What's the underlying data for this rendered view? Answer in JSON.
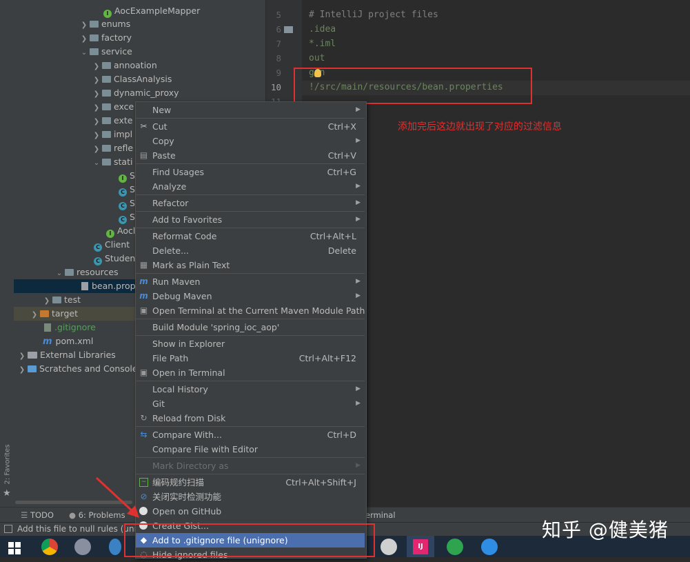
{
  "tree": {
    "items": [
      {
        "label": "AocExampleMapper"
      },
      {
        "label": "enums"
      },
      {
        "label": "factory"
      },
      {
        "label": "service"
      },
      {
        "label": "annoation"
      },
      {
        "label": "ClassAnalysis"
      },
      {
        "label": "dynamic_proxy"
      },
      {
        "label": "exce"
      },
      {
        "label": "exte"
      },
      {
        "label": "impl"
      },
      {
        "label": "refle"
      },
      {
        "label": "stati"
      },
      {
        "label": "S"
      },
      {
        "label": "S"
      },
      {
        "label": "S"
      },
      {
        "label": "S"
      },
      {
        "label": "Aocl"
      },
      {
        "label": "Client"
      },
      {
        "label": "Student"
      },
      {
        "label": "resources"
      },
      {
        "label": "bean.prop"
      },
      {
        "label": "test"
      },
      {
        "label": "target"
      },
      {
        "label": ".gitignore"
      },
      {
        "label": "pom.xml"
      },
      {
        "label": "External Libraries"
      },
      {
        "label": "Scratches and Console"
      }
    ]
  },
  "editor": {
    "lines": [
      {
        "num": "5",
        "text": "# IntelliJ project files"
      },
      {
        "num": "6",
        "text": ".idea"
      },
      {
        "num": "7",
        "text": "*.iml"
      },
      {
        "num": "8",
        "text": "out"
      },
      {
        "num": "9",
        "text": "gen"
      },
      {
        "num": "10",
        "text": "!/src/main/resources/bean.properties"
      }
    ],
    "next_line_num": "11"
  },
  "annotation": "添加完后这边就出现了对应的过滤信息",
  "menu": {
    "items": [
      {
        "label": "New",
        "shortcut": ""
      },
      {
        "label": "Cut",
        "shortcut": "Ctrl+X"
      },
      {
        "label": "Copy",
        "shortcut": ""
      },
      {
        "label": "Paste",
        "shortcut": "Ctrl+V"
      },
      {
        "label": "Find Usages",
        "shortcut": "Ctrl+G"
      },
      {
        "label": "Analyze",
        "shortcut": ""
      },
      {
        "label": "Refactor",
        "shortcut": ""
      },
      {
        "label": "Add to Favorites",
        "shortcut": ""
      },
      {
        "label": "Reformat Code",
        "shortcut": "Ctrl+Alt+L"
      },
      {
        "label": "Delete...",
        "shortcut": "Delete"
      },
      {
        "label": "Mark as Plain Text",
        "shortcut": ""
      },
      {
        "label": "Run Maven",
        "shortcut": ""
      },
      {
        "label": "Debug Maven",
        "shortcut": ""
      },
      {
        "label": "Open Terminal at the Current Maven Module Path",
        "shortcut": ""
      },
      {
        "label": "Build Module 'spring_ioc_aop'",
        "shortcut": ""
      },
      {
        "label": "Show in Explorer",
        "shortcut": ""
      },
      {
        "label": "File Path",
        "shortcut": "Ctrl+Alt+F12"
      },
      {
        "label": "Open in Terminal",
        "shortcut": ""
      },
      {
        "label": "Local History",
        "shortcut": ""
      },
      {
        "label": "Git",
        "shortcut": ""
      },
      {
        "label": "Reload from Disk",
        "shortcut": ""
      },
      {
        "label": "Compare With...",
        "shortcut": "Ctrl+D"
      },
      {
        "label": "Compare File with Editor",
        "shortcut": ""
      },
      {
        "label": "Mark Directory as",
        "shortcut": ""
      },
      {
        "label": "编码规约扫描",
        "shortcut": "Ctrl+Alt+Shift+J"
      },
      {
        "label": "关闭实时检测功能",
        "shortcut": ""
      },
      {
        "label": "Open on GitHub",
        "shortcut": ""
      },
      {
        "label": "Create Gist...",
        "shortcut": ""
      },
      {
        "label": "Add to .gitignore file (unignore)",
        "shortcut": ""
      },
      {
        "label": "Hide ignored files",
        "shortcut": ""
      }
    ]
  },
  "toolbar": {
    "todo": "TODO",
    "problems": "6: Problems",
    "terminal": "erminal",
    "favorites": "2: Favorites"
  },
  "status": {
    "text": "Add this file to null rules (unig"
  },
  "watermark": "知乎 @健美猪",
  "colors": {
    "accent": "#4b6eaf",
    "annotation": "#e03131"
  }
}
